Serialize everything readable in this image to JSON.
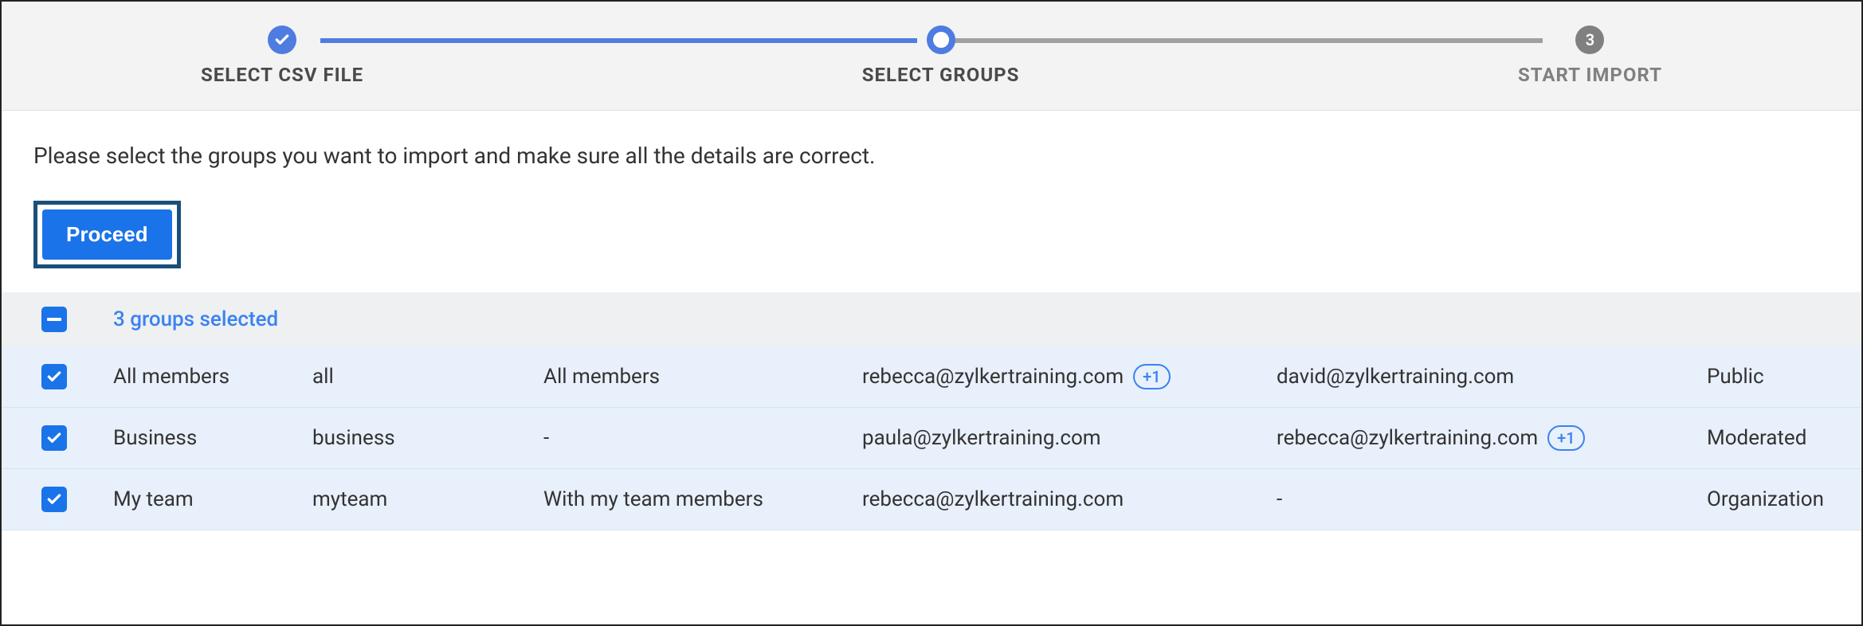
{
  "stepper": {
    "steps": [
      {
        "label": "SELECT CSV FILE",
        "state": "completed"
      },
      {
        "label": "SELECT GROUPS",
        "state": "active"
      },
      {
        "label": "START IMPORT",
        "state": "pending",
        "number": "3"
      }
    ]
  },
  "instruction": "Please select the groups you want to import and make sure all the details are correct.",
  "proceed_label": "Proceed",
  "selection_summary": "3 groups selected",
  "rows": [
    {
      "name": "All members",
      "alias": "all",
      "description": "All members",
      "email1": "rebecca@zylkertraining.com",
      "email1_more": "+1",
      "email2": "david@zylkertraining.com",
      "email2_more": "",
      "access": "Public"
    },
    {
      "name": "Business",
      "alias": "business",
      "description": "-",
      "email1": "paula@zylkertraining.com",
      "email1_more": "",
      "email2": "rebecca@zylkertraining.com",
      "email2_more": "+1",
      "access": "Moderated"
    },
    {
      "name": "My team",
      "alias": "myteam",
      "description": "With my team members",
      "email1": "rebecca@zylkertraining.com",
      "email1_more": "",
      "email2": "-",
      "email2_more": "",
      "access": "Organization"
    }
  ]
}
